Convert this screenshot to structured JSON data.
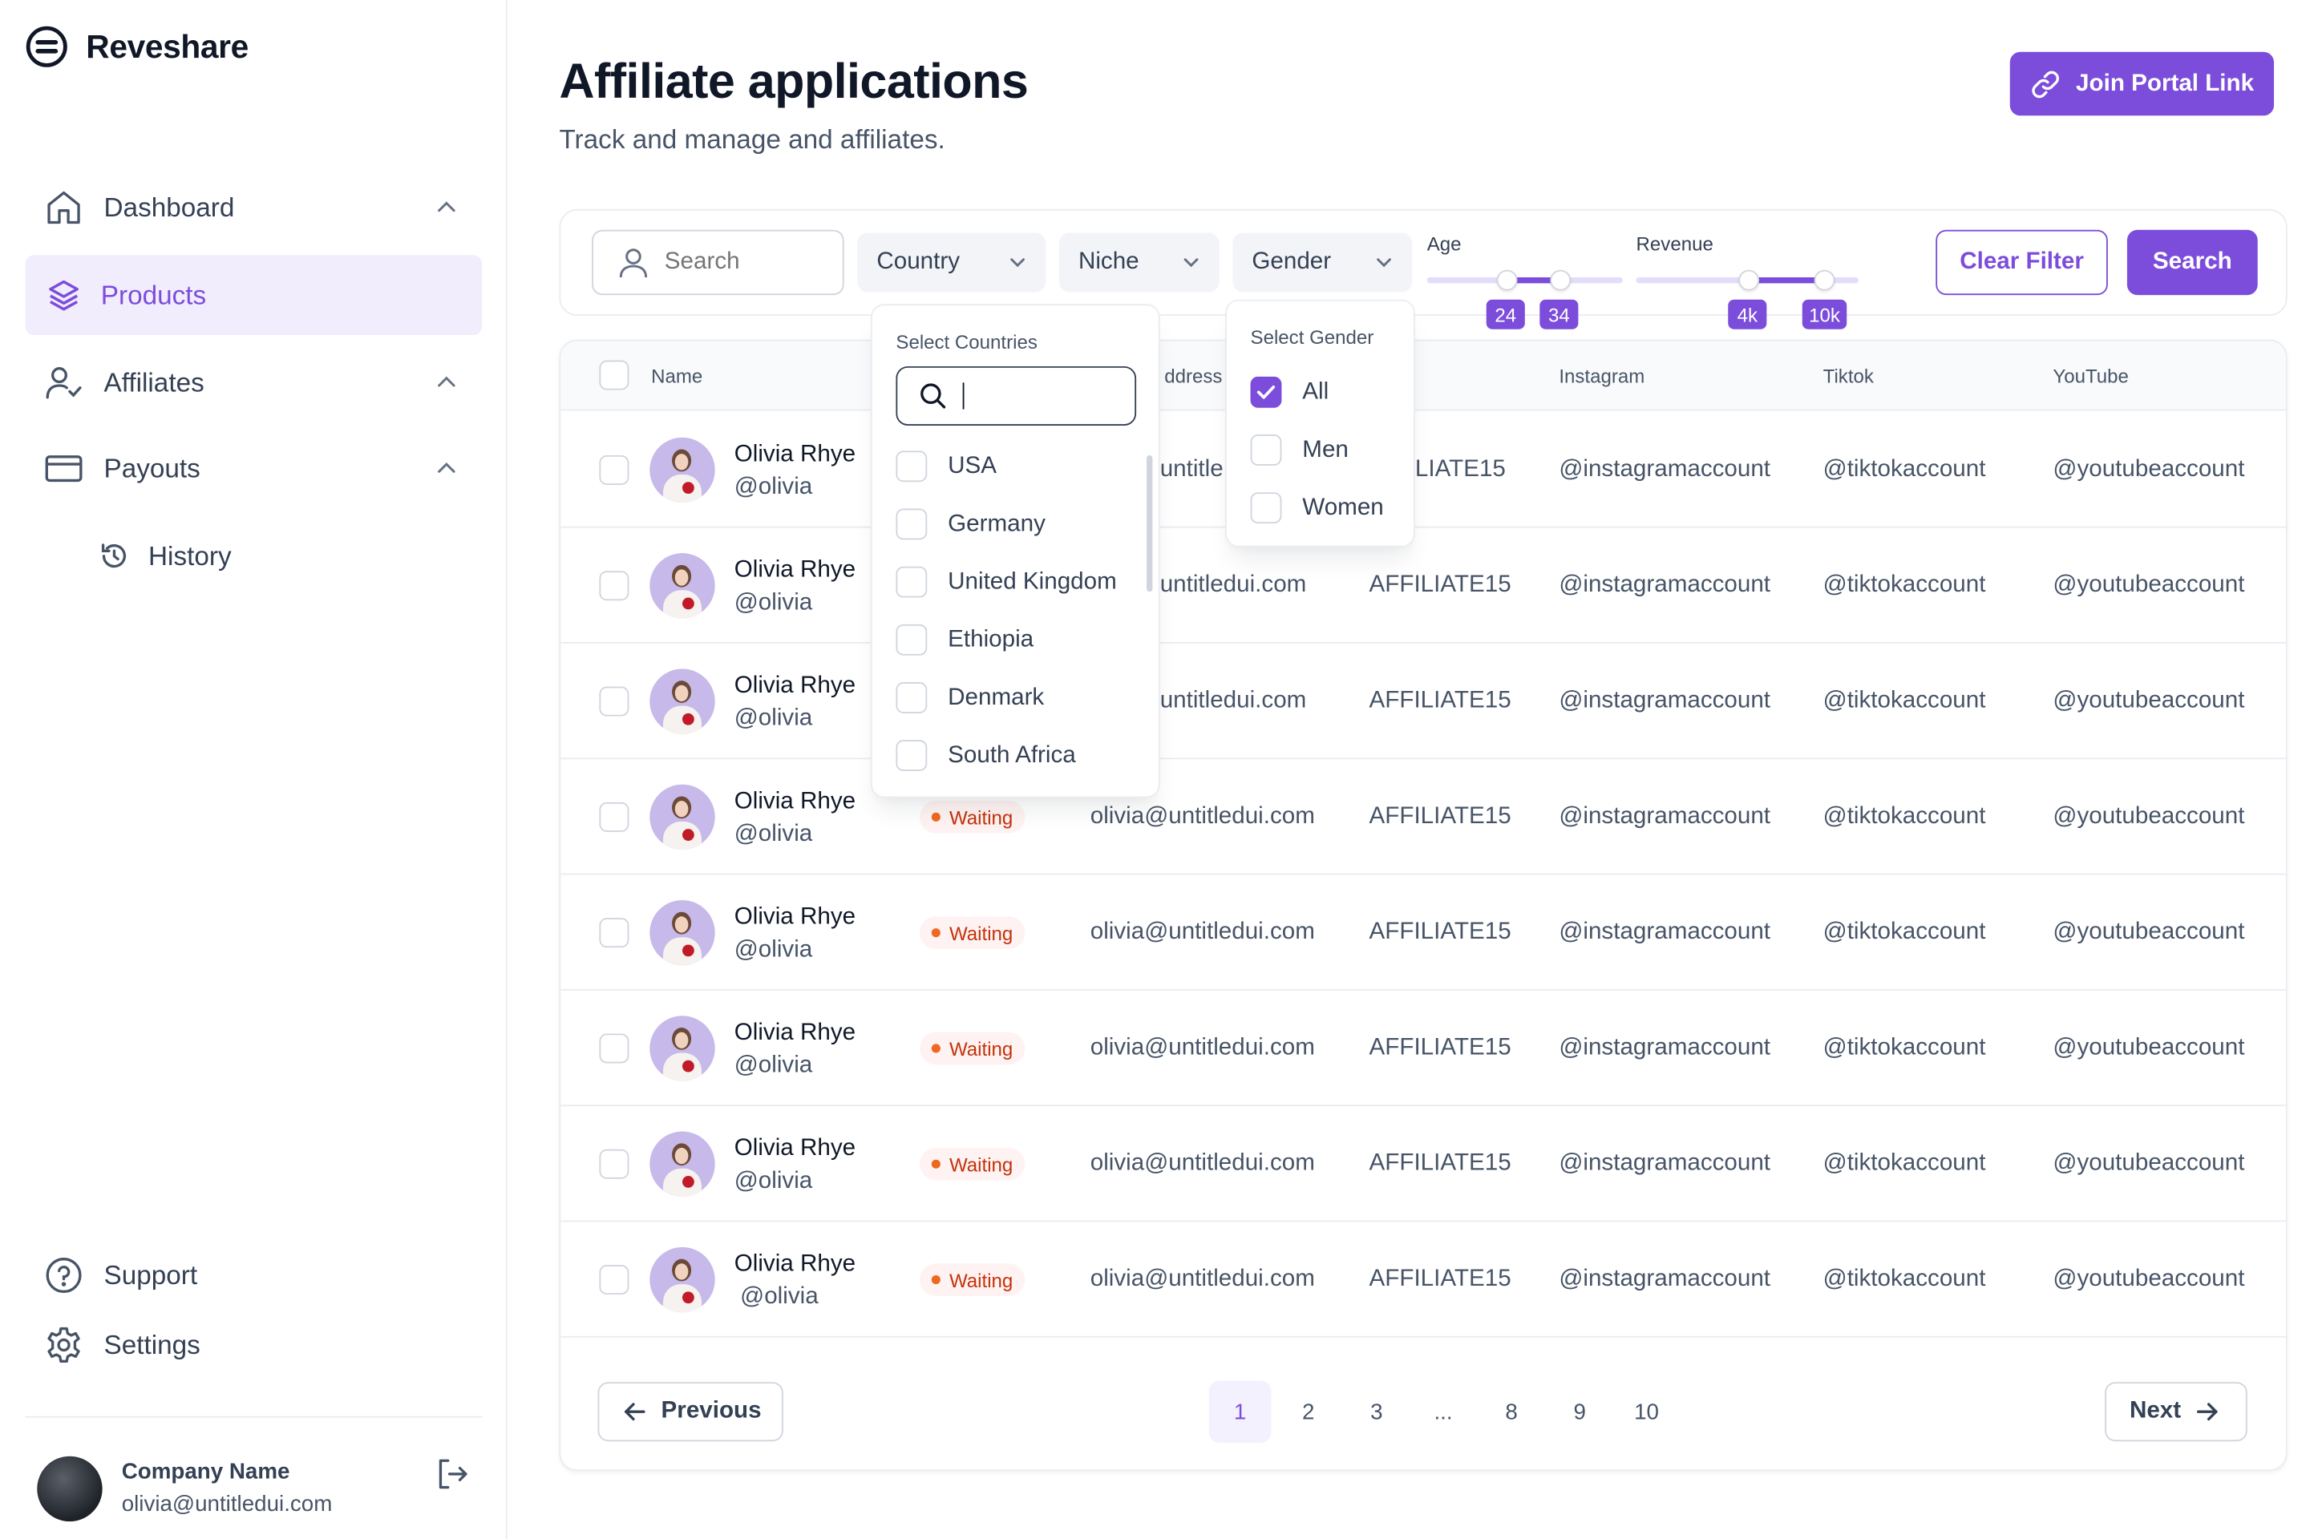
{
  "app": {
    "name": "Reveshare"
  },
  "nav": {
    "dashboard": "Dashboard",
    "products": "Products",
    "affiliates": "Affiliates",
    "payouts": "Payouts",
    "history": "History",
    "support": "Support",
    "settings": "Settings"
  },
  "account": {
    "name": "Company Name",
    "email": "olivia@untitledui.com"
  },
  "header": {
    "title": "Affiliate applications",
    "subtitle": "Track and manage and affiliates.",
    "join_button": "Join Portal Link"
  },
  "filters": {
    "search_placeholder": "Search",
    "country": "Country",
    "niche": "Niche",
    "gender": "Gender",
    "age_label": "Age",
    "age_min": "24",
    "age_max": "34",
    "revenue_label": "Revenue",
    "revenue_min": "4k",
    "revenue_max": "10k",
    "clear_button": "Clear Filter",
    "search_button": "Search"
  },
  "country_dropdown": {
    "title": "Select Countries",
    "options": [
      "USA",
      "Germany",
      "United Kingdom",
      "Ethiopia",
      "Denmark",
      "South Africa"
    ]
  },
  "gender_dropdown": {
    "title": "Select Gender",
    "options": [
      {
        "label": "All",
        "checked": true
      },
      {
        "label": "Men",
        "checked": false
      },
      {
        "label": "Women",
        "checked": false
      }
    ]
  },
  "table": {
    "headers": {
      "name": "Name",
      "email": "ddress",
      "instagram": "Instagram",
      "tiktok": "Tiktok",
      "youtube": "YouTube"
    },
    "rows": [
      {
        "name": "Olivia Rhye",
        "handle": "@olivia",
        "status": "",
        "email": "untitle",
        "code": "LIATE15",
        "instagram": "@instagramaccount",
        "tiktok": "@tiktokaccount",
        "youtube": "@youtubeaccount"
      },
      {
        "name": "Olivia Rhye",
        "handle": "@olivia",
        "status": "",
        "email": "untitledui.com",
        "code": "AFFILIATE15",
        "instagram": "@instagramaccount",
        "tiktok": "@tiktokaccount",
        "youtube": "@youtubeaccount"
      },
      {
        "name": "Olivia Rhye",
        "handle": "@olivia",
        "status": "",
        "email": "untitledui.com",
        "code": "AFFILIATE15",
        "instagram": "@instagramaccount",
        "tiktok": "@tiktokaccount",
        "youtube": "@youtubeaccount"
      },
      {
        "name": "Olivia Rhye",
        "handle": "@olivia",
        "status": "Waiting",
        "email": "olivia@untitledui.com",
        "code": "AFFILIATE15",
        "instagram": "@instagramaccount",
        "tiktok": "@tiktokaccount",
        "youtube": "@youtubeaccount"
      },
      {
        "name": "Olivia Rhye",
        "handle": "@olivia",
        "status": "Waiting",
        "email": "olivia@untitledui.com",
        "code": "AFFILIATE15",
        "instagram": "@instagramaccount",
        "tiktok": "@tiktokaccount",
        "youtube": "@youtubeaccount"
      },
      {
        "name": "Olivia Rhye",
        "handle": "@olivia",
        "status": "Waiting",
        "email": "olivia@untitledui.com",
        "code": "AFFILIATE15",
        "instagram": "@instagramaccount",
        "tiktok": "@tiktokaccount",
        "youtube": "@youtubeaccount"
      },
      {
        "name": "Olivia Rhye",
        "handle": "@olivia",
        "status": "Waiting",
        "email": "olivia@untitledui.com",
        "code": "AFFILIATE15",
        "instagram": "@instagramaccount",
        "tiktok": "@tiktokaccount",
        "youtube": "@youtubeaccount"
      },
      {
        "name": "Olivia Rhye",
        "handle": "@olivia",
        "status": "Waiting",
        "email": "olivia@untitledui.com",
        "code": "AFFILIATE15",
        "instagram": "@instagramaccount",
        "tiktok": "@tiktokaccount",
        "youtube": "@youtubeaccount"
      }
    ]
  },
  "pagination": {
    "previous": "Previous",
    "next": "Next",
    "pages": [
      "1",
      "2",
      "3",
      "...",
      "8",
      "9",
      "10"
    ],
    "current": "1"
  },
  "colors": {
    "accent": "#7c4ddb",
    "accent_soft": "#f1edfd",
    "status_waiting": "#c4320a"
  }
}
